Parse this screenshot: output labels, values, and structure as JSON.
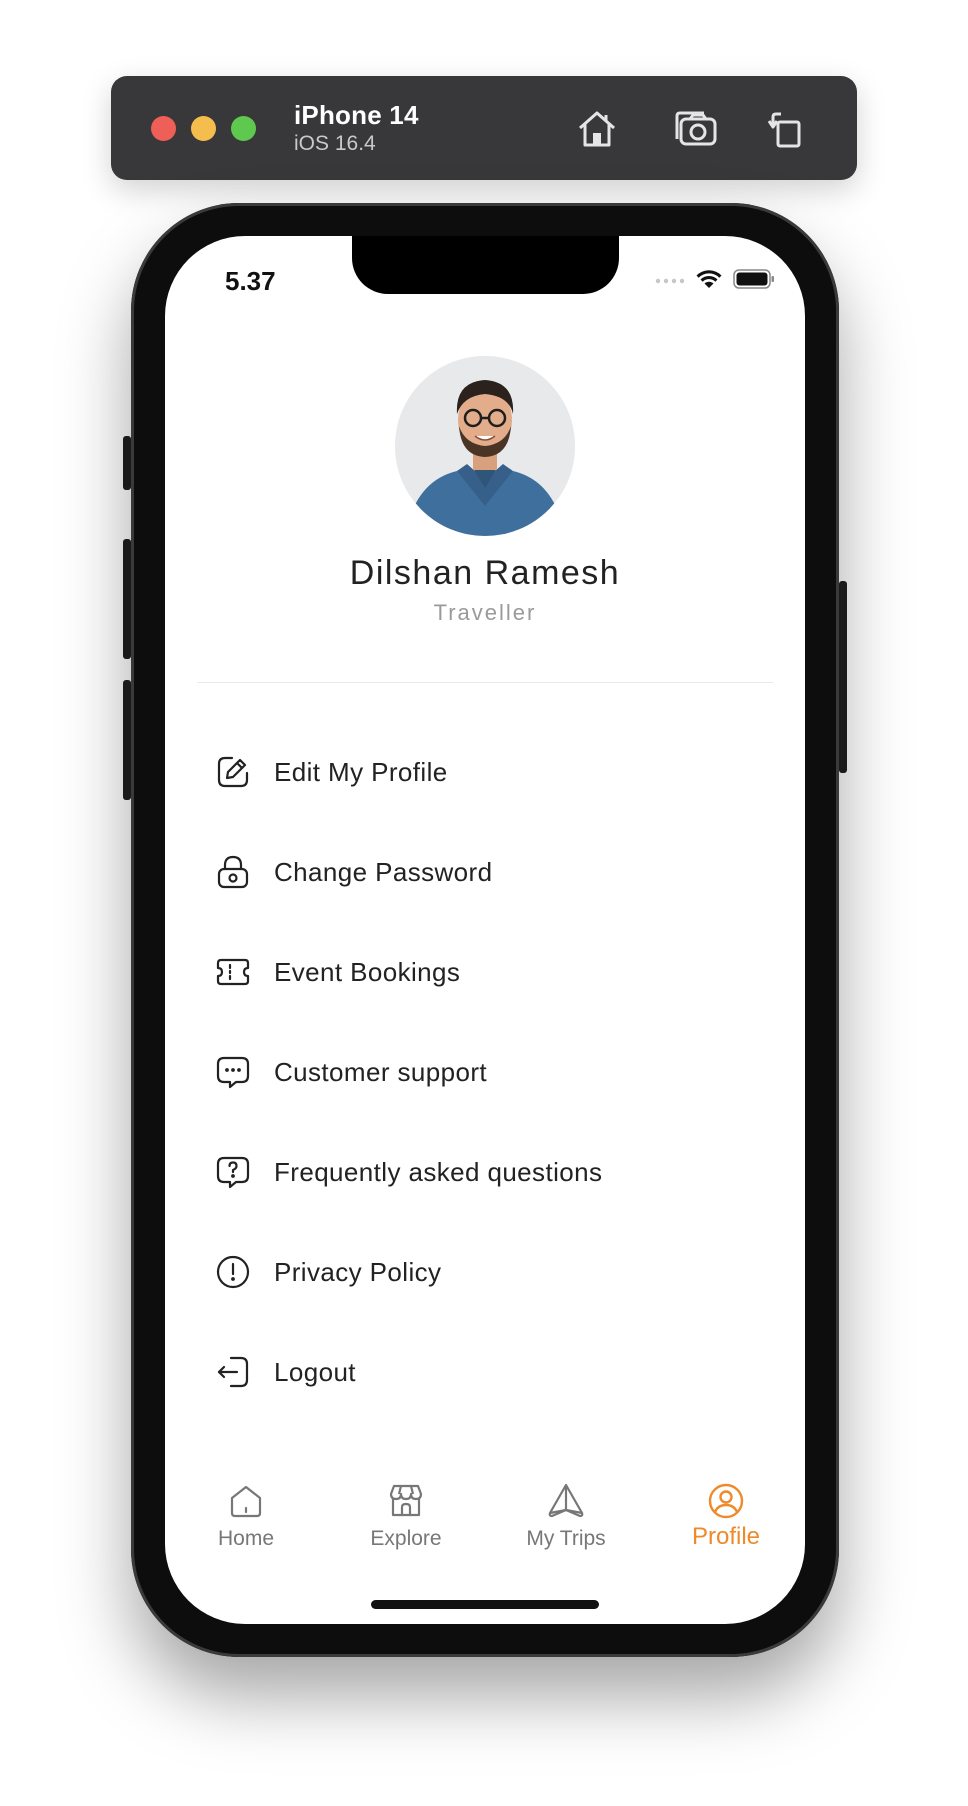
{
  "simulator": {
    "device_name": "iPhone 14",
    "os_version": "iOS 16.4",
    "buttons": [
      "home-icon",
      "screenshot-icon",
      "rotate-icon"
    ]
  },
  "status_bar": {
    "time": "5.37"
  },
  "profile": {
    "name": "Dilshan Ramesh",
    "role": "Traveller"
  },
  "menu": [
    {
      "icon": "edit-icon",
      "label": "Edit My Profile"
    },
    {
      "icon": "lock-icon",
      "label": "Change Password"
    },
    {
      "icon": "ticket-icon",
      "label": "Event Bookings"
    },
    {
      "icon": "chat-icon",
      "label": "Customer support"
    },
    {
      "icon": "help-icon",
      "label": "Frequently asked questions"
    },
    {
      "icon": "alert-icon",
      "label": "Privacy Policy"
    },
    {
      "icon": "logout-icon",
      "label": "Logout"
    }
  ],
  "tabbar": {
    "tabs": [
      {
        "icon": "home-icon",
        "label": "Home"
      },
      {
        "icon": "store-icon",
        "label": "Explore"
      },
      {
        "icon": "navigate-icon",
        "label": "My Trips"
      },
      {
        "icon": "user-icon",
        "label": "Profile"
      }
    ],
    "active": "Profile"
  },
  "colors": {
    "accent": "#ee8a2a",
    "text": "#222222",
    "muted": "#9a9a9a"
  }
}
